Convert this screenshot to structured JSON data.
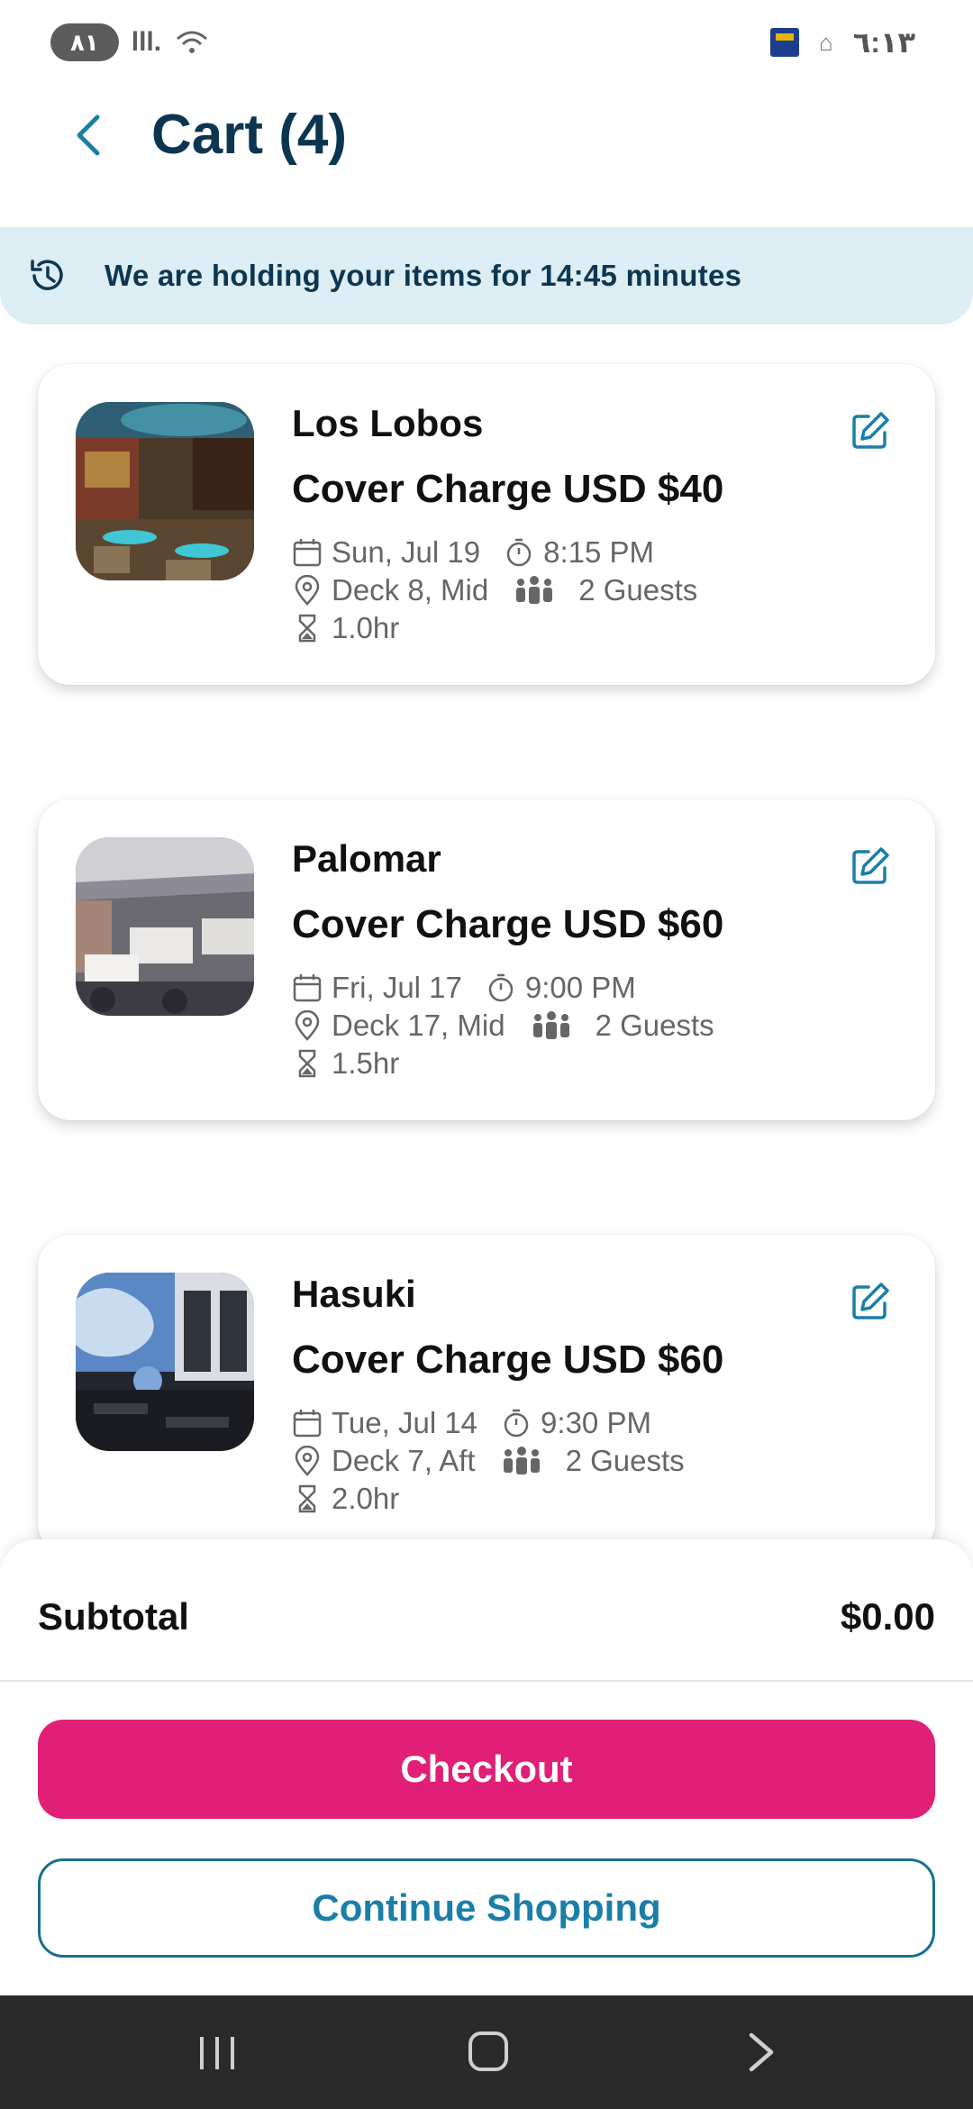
{
  "status_bar": {
    "pill_text": "٨١",
    "signal_text": "lll.",
    "time": "٦:١٣"
  },
  "header": {
    "title": "Cart (4)"
  },
  "banner": {
    "text": "We are holding your items for 14:45 minutes"
  },
  "cart_items": [
    {
      "name": "Los Lobos",
      "price": "Cover Charge USD $40",
      "date": "Sun, Jul 19",
      "time": "8:15 PM",
      "location": "Deck 8, Mid",
      "guests": "2 Guests",
      "duration": "1.0hr"
    },
    {
      "name": "Palomar",
      "price": "Cover Charge USD $60",
      "date": "Fri, Jul 17",
      "time": "9:00 PM",
      "location": "Deck 17, Mid",
      "guests": "2 Guests",
      "duration": "1.5hr"
    },
    {
      "name": "Hasuki",
      "price": "Cover Charge USD $60",
      "date": "Tue, Jul 14",
      "time": "9:30 PM",
      "location": "Deck 7, Aft",
      "guests": "2 Guests",
      "duration": "2.0hr"
    }
  ],
  "summary": {
    "subtotal_label": "Subtotal",
    "subtotal_value": "$0.00"
  },
  "actions": {
    "checkout_label": "Checkout",
    "continue_label": "Continue Shopping"
  },
  "colors": {
    "primary_dark": "#0b3551",
    "accent_teal": "#1a7fa8",
    "checkout_pink": "#e11f76",
    "banner_bg": "#dcedf4"
  },
  "icons": {
    "back": "chevron-left-icon",
    "banner": "history-clock-icon",
    "edit": "edit-pencil-icon",
    "date": "calendar-icon",
    "time": "stopwatch-icon",
    "location": "location-pin-icon",
    "guests": "guests-icon",
    "duration": "hourglass-icon"
  }
}
